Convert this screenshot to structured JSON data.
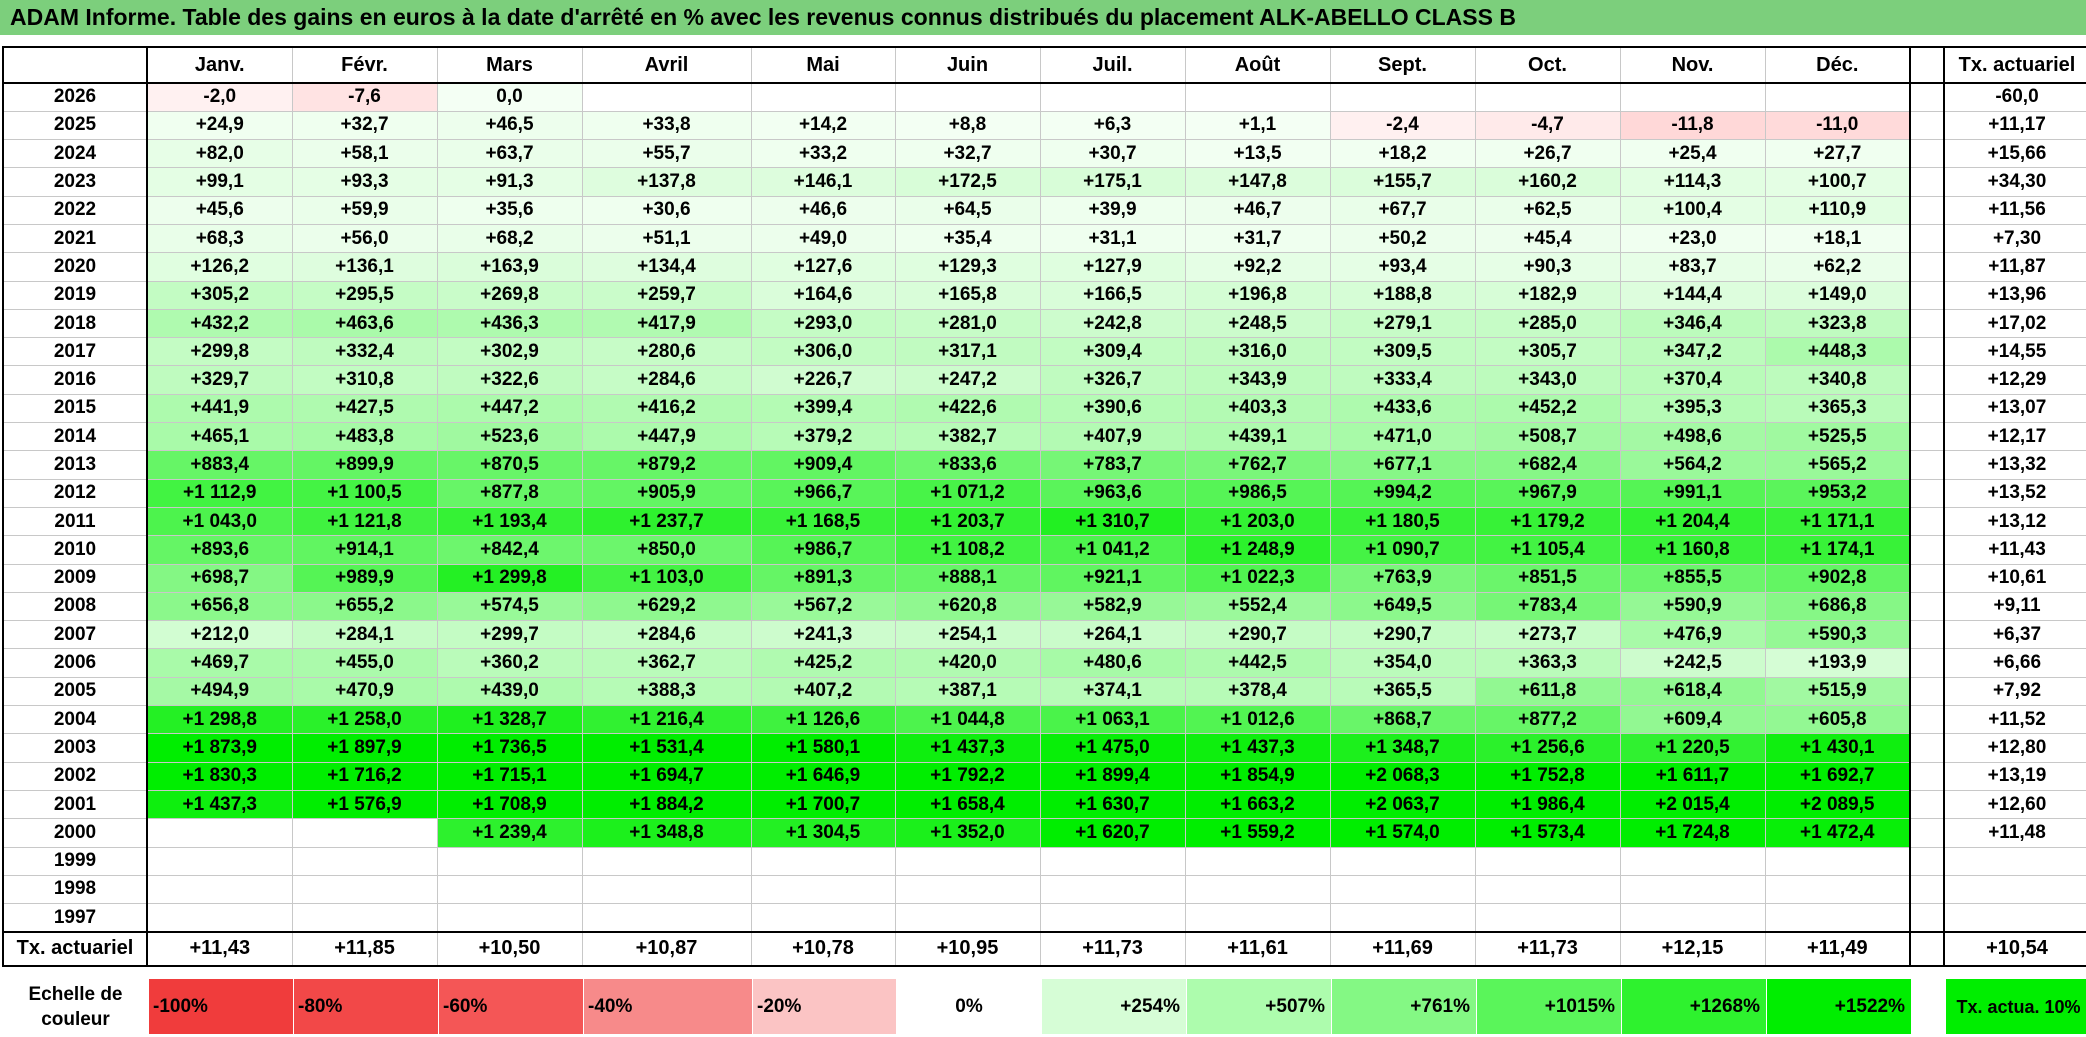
{
  "title": "ADAM Informe. Table des gains en euros à la date d'arrêté en % avec les revenus connus distribués du placement ALK-ABELLO CLASS B",
  "months": [
    "Janv.",
    "Févr.",
    "Mars",
    "Avril",
    "Mai",
    "Juin",
    "Juil.",
    "Août",
    "Sept.",
    "Oct.",
    "Nov.",
    "Déc."
  ],
  "tx_header": "Tx. actuariel",
  "rows": [
    {
      "year": "2026",
      "values": [
        "-2,0",
        "-7,6",
        "0,0",
        "",
        "",
        "",
        "",
        "",
        "",
        "",
        "",
        ""
      ],
      "tx": "-60,0"
    },
    {
      "year": "2025",
      "values": [
        "+24,9",
        "+32,7",
        "+46,5",
        "+33,8",
        "+14,2",
        "+8,8",
        "+6,3",
        "+1,1",
        "-2,4",
        "-4,7",
        "-11,8",
        "-11,0"
      ],
      "tx": "+11,17"
    },
    {
      "year": "2024",
      "values": [
        "+82,0",
        "+58,1",
        "+63,7",
        "+55,7",
        "+33,2",
        "+32,7",
        "+30,7",
        "+13,5",
        "+18,2",
        "+26,7",
        "+25,4",
        "+27,7"
      ],
      "tx": "+15,66"
    },
    {
      "year": "2023",
      "values": [
        "+99,1",
        "+93,3",
        "+91,3",
        "+137,8",
        "+146,1",
        "+172,5",
        "+175,1",
        "+147,8",
        "+155,7",
        "+160,2",
        "+114,3",
        "+100,7"
      ],
      "tx": "+34,30"
    },
    {
      "year": "2022",
      "values": [
        "+45,6",
        "+59,9",
        "+35,6",
        "+30,6",
        "+46,6",
        "+64,5",
        "+39,9",
        "+46,7",
        "+67,7",
        "+62,5",
        "+100,4",
        "+110,9"
      ],
      "tx": "+11,56"
    },
    {
      "year": "2021",
      "values": [
        "+68,3",
        "+56,0",
        "+68,2",
        "+51,1",
        "+49,0",
        "+35,4",
        "+31,1",
        "+31,7",
        "+50,2",
        "+45,4",
        "+23,0",
        "+18,1"
      ],
      "tx": "+7,30"
    },
    {
      "year": "2020",
      "values": [
        "+126,2",
        "+136,1",
        "+163,9",
        "+134,4",
        "+127,6",
        "+129,3",
        "+127,9",
        "+92,2",
        "+93,4",
        "+90,3",
        "+83,7",
        "+62,2"
      ],
      "tx": "+11,87"
    },
    {
      "year": "2019",
      "values": [
        "+305,2",
        "+295,5",
        "+269,8",
        "+259,7",
        "+164,6",
        "+165,8",
        "+166,5",
        "+196,8",
        "+188,8",
        "+182,9",
        "+144,4",
        "+149,0"
      ],
      "tx": "+13,96"
    },
    {
      "year": "2018",
      "values": [
        "+432,2",
        "+463,6",
        "+436,3",
        "+417,9",
        "+293,0",
        "+281,0",
        "+242,8",
        "+248,5",
        "+279,1",
        "+285,0",
        "+346,4",
        "+323,8"
      ],
      "tx": "+17,02"
    },
    {
      "year": "2017",
      "values": [
        "+299,8",
        "+332,4",
        "+302,9",
        "+280,6",
        "+306,0",
        "+317,1",
        "+309,4",
        "+316,0",
        "+309,5",
        "+305,7",
        "+347,2",
        "+448,3"
      ],
      "tx": "+14,55"
    },
    {
      "year": "2016",
      "values": [
        "+329,7",
        "+310,8",
        "+322,6",
        "+284,6",
        "+226,7",
        "+247,2",
        "+326,7",
        "+343,9",
        "+333,4",
        "+343,0",
        "+370,4",
        "+340,8"
      ],
      "tx": "+12,29"
    },
    {
      "year": "2015",
      "values": [
        "+441,9",
        "+427,5",
        "+447,2",
        "+416,2",
        "+399,4",
        "+422,6",
        "+390,6",
        "+403,3",
        "+433,6",
        "+452,2",
        "+395,3",
        "+365,3"
      ],
      "tx": "+13,07"
    },
    {
      "year": "2014",
      "values": [
        "+465,1",
        "+483,8",
        "+523,6",
        "+447,9",
        "+379,2",
        "+382,7",
        "+407,9",
        "+439,1",
        "+471,0",
        "+508,7",
        "+498,6",
        "+525,5"
      ],
      "tx": "+12,17"
    },
    {
      "year": "2013",
      "values": [
        "+883,4",
        "+899,9",
        "+870,5",
        "+879,2",
        "+909,4",
        "+833,6",
        "+783,7",
        "+762,7",
        "+677,1",
        "+682,4",
        "+564,2",
        "+565,2"
      ],
      "tx": "+13,32"
    },
    {
      "year": "2012",
      "values": [
        "+1 112,9",
        "+1 100,5",
        "+877,8",
        "+905,9",
        "+966,7",
        "+1 071,2",
        "+963,6",
        "+986,5",
        "+994,2",
        "+967,9",
        "+991,1",
        "+953,2"
      ],
      "tx": "+13,52"
    },
    {
      "year": "2011",
      "values": [
        "+1 043,0",
        "+1 121,8",
        "+1 193,4",
        "+1 237,7",
        "+1 168,5",
        "+1 203,7",
        "+1 310,7",
        "+1 203,0",
        "+1 180,5",
        "+1 179,2",
        "+1 204,4",
        "+1 171,1"
      ],
      "tx": "+13,12"
    },
    {
      "year": "2010",
      "values": [
        "+893,6",
        "+914,1",
        "+842,4",
        "+850,0",
        "+986,7",
        "+1 108,2",
        "+1 041,2",
        "+1 248,9",
        "+1 090,7",
        "+1 105,4",
        "+1 160,8",
        "+1 174,1"
      ],
      "tx": "+11,43"
    },
    {
      "year": "2009",
      "values": [
        "+698,7",
        "+989,9",
        "+1 299,8",
        "+1 103,0",
        "+891,3",
        "+888,1",
        "+921,1",
        "+1 022,3",
        "+763,9",
        "+851,5",
        "+855,5",
        "+902,8"
      ],
      "tx": "+10,61"
    },
    {
      "year": "2008",
      "values": [
        "+656,8",
        "+655,2",
        "+574,5",
        "+629,2",
        "+567,2",
        "+620,8",
        "+582,9",
        "+552,4",
        "+649,5",
        "+783,4",
        "+590,9",
        "+686,8"
      ],
      "tx": "+9,11"
    },
    {
      "year": "2007",
      "values": [
        "+212,0",
        "+284,1",
        "+299,7",
        "+284,6",
        "+241,3",
        "+254,1",
        "+264,1",
        "+290,7",
        "+290,7",
        "+273,7",
        "+476,9",
        "+590,3"
      ],
      "tx": "+6,37"
    },
    {
      "year": "2006",
      "values": [
        "+469,7",
        "+455,0",
        "+360,2",
        "+362,7",
        "+425,2",
        "+420,0",
        "+480,6",
        "+442,5",
        "+354,0",
        "+363,3",
        "+242,5",
        "+193,9"
      ],
      "tx": "+6,66"
    },
    {
      "year": "2005",
      "values": [
        "+494,9",
        "+470,9",
        "+439,0",
        "+388,3",
        "+407,2",
        "+387,1",
        "+374,1",
        "+378,4",
        "+365,5",
        "+611,8",
        "+618,4",
        "+515,9"
      ],
      "tx": "+7,92"
    },
    {
      "year": "2004",
      "values": [
        "+1 298,8",
        "+1 258,0",
        "+1 328,7",
        "+1 216,4",
        "+1 126,6",
        "+1 044,8",
        "+1 063,1",
        "+1 012,6",
        "+868,7",
        "+877,2",
        "+609,4",
        "+605,8"
      ],
      "tx": "+11,52"
    },
    {
      "year": "2003",
      "values": [
        "+1 873,9",
        "+1 897,9",
        "+1 736,5",
        "+1 531,4",
        "+1 580,1",
        "+1 437,3",
        "+1 475,0",
        "+1 437,3",
        "+1 348,7",
        "+1 256,6",
        "+1 220,5",
        "+1 430,1"
      ],
      "tx": "+12,80"
    },
    {
      "year": "2002",
      "values": [
        "+1 830,3",
        "+1 716,2",
        "+1 715,1",
        "+1 694,7",
        "+1 646,9",
        "+1 792,2",
        "+1 899,4",
        "+1 854,9",
        "+2 068,3",
        "+1 752,8",
        "+1 611,7",
        "+1 692,7"
      ],
      "tx": "+13,19"
    },
    {
      "year": "2001",
      "values": [
        "+1 437,3",
        "+1 576,9",
        "+1 708,9",
        "+1 884,2",
        "+1 700,7",
        "+1 658,4",
        "+1 630,7",
        "+1 663,2",
        "+2 063,7",
        "+1 986,4",
        "+2 015,4",
        "+2 089,5"
      ],
      "tx": "+12,60"
    },
    {
      "year": "2000",
      "values": [
        "",
        "",
        "+1 239,4",
        "+1 348,8",
        "+1 304,5",
        "+1 352,0",
        "+1 620,7",
        "+1 559,2",
        "+1 574,0",
        "+1 573,4",
        "+1 724,8",
        "+1 472,4"
      ],
      "tx": "+11,48"
    },
    {
      "year": "1999",
      "values": [
        "",
        "",
        "",
        "",
        "",
        "",
        "",
        "",
        "",
        "",
        "",
        ""
      ],
      "tx": ""
    },
    {
      "year": "1998",
      "values": [
        "",
        "",
        "",
        "",
        "",
        "",
        "",
        "",
        "",
        "",
        "",
        ""
      ],
      "tx": ""
    },
    {
      "year": "1997",
      "values": [
        "",
        "",
        "",
        "",
        "",
        "",
        "",
        "",
        "",
        "",
        "",
        ""
      ],
      "tx": ""
    }
  ],
  "footer": {
    "label": "Tx. actuariel",
    "values": [
      "+11,43",
      "+11,85",
      "+10,50",
      "+10,87",
      "+10,78",
      "+10,95",
      "+11,73",
      "+11,61",
      "+11,69",
      "+11,73",
      "+12,15",
      "+11,49"
    ],
    "tx": "+10,54"
  },
  "scale": {
    "label": "Echelle de couleur",
    "items": [
      {
        "text": "-100%",
        "color": "#f03c3c"
      },
      {
        "text": "-80%",
        "color": "#f24848"
      },
      {
        "text": "-60%",
        "color": "#f45656"
      },
      {
        "text": "-40%",
        "color": "#f78a8a"
      },
      {
        "text": "-20%",
        "color": "#fbc4c4"
      },
      {
        "text": "0%",
        "color": "#ffffff"
      },
      {
        "text": "+254%",
        "color": "#d6fdd6"
      },
      {
        "text": "+507%",
        "color": "#adfcad"
      },
      {
        "text": "+761%",
        "color": "#84f884"
      },
      {
        "text": "+1015%",
        "color": "#5af55a"
      },
      {
        "text": "+1268%",
        "color": "#2ef22e"
      },
      {
        "text": "+1522%",
        "color": "#00ee00"
      }
    ],
    "actuarial_label": "Tx. actua. 10%",
    "actuarial_color": "#00ee00"
  }
}
